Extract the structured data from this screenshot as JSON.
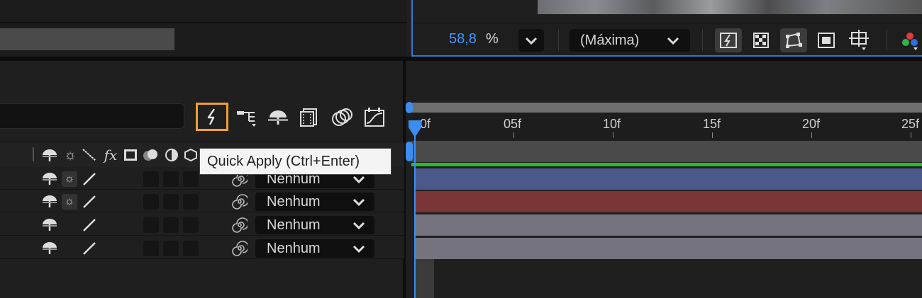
{
  "viewer": {
    "zoom_value": "58,8",
    "zoom_unit": "%",
    "resolution": "(Máxima)"
  },
  "tooltip": {
    "text": "Quick Apply (Ctrl+Enter)"
  },
  "ruler": {
    "start": "0f",
    "ticks": [
      "05f",
      "10f",
      "15f",
      "20f",
      "25f"
    ]
  },
  "layers": [
    {
      "parent": "Nenhum",
      "color": "#4a5989"
    },
    {
      "parent": "Nenhum",
      "color": "#7a3537"
    },
    {
      "parent": "Nenhum",
      "color": "#75747e"
    },
    {
      "parent": "Nenhum",
      "color": "#75747e"
    }
  ],
  "colors": {
    "accent": "#3f96ff",
    "highlight": "#f0a030",
    "green": "#2dbb2d"
  }
}
